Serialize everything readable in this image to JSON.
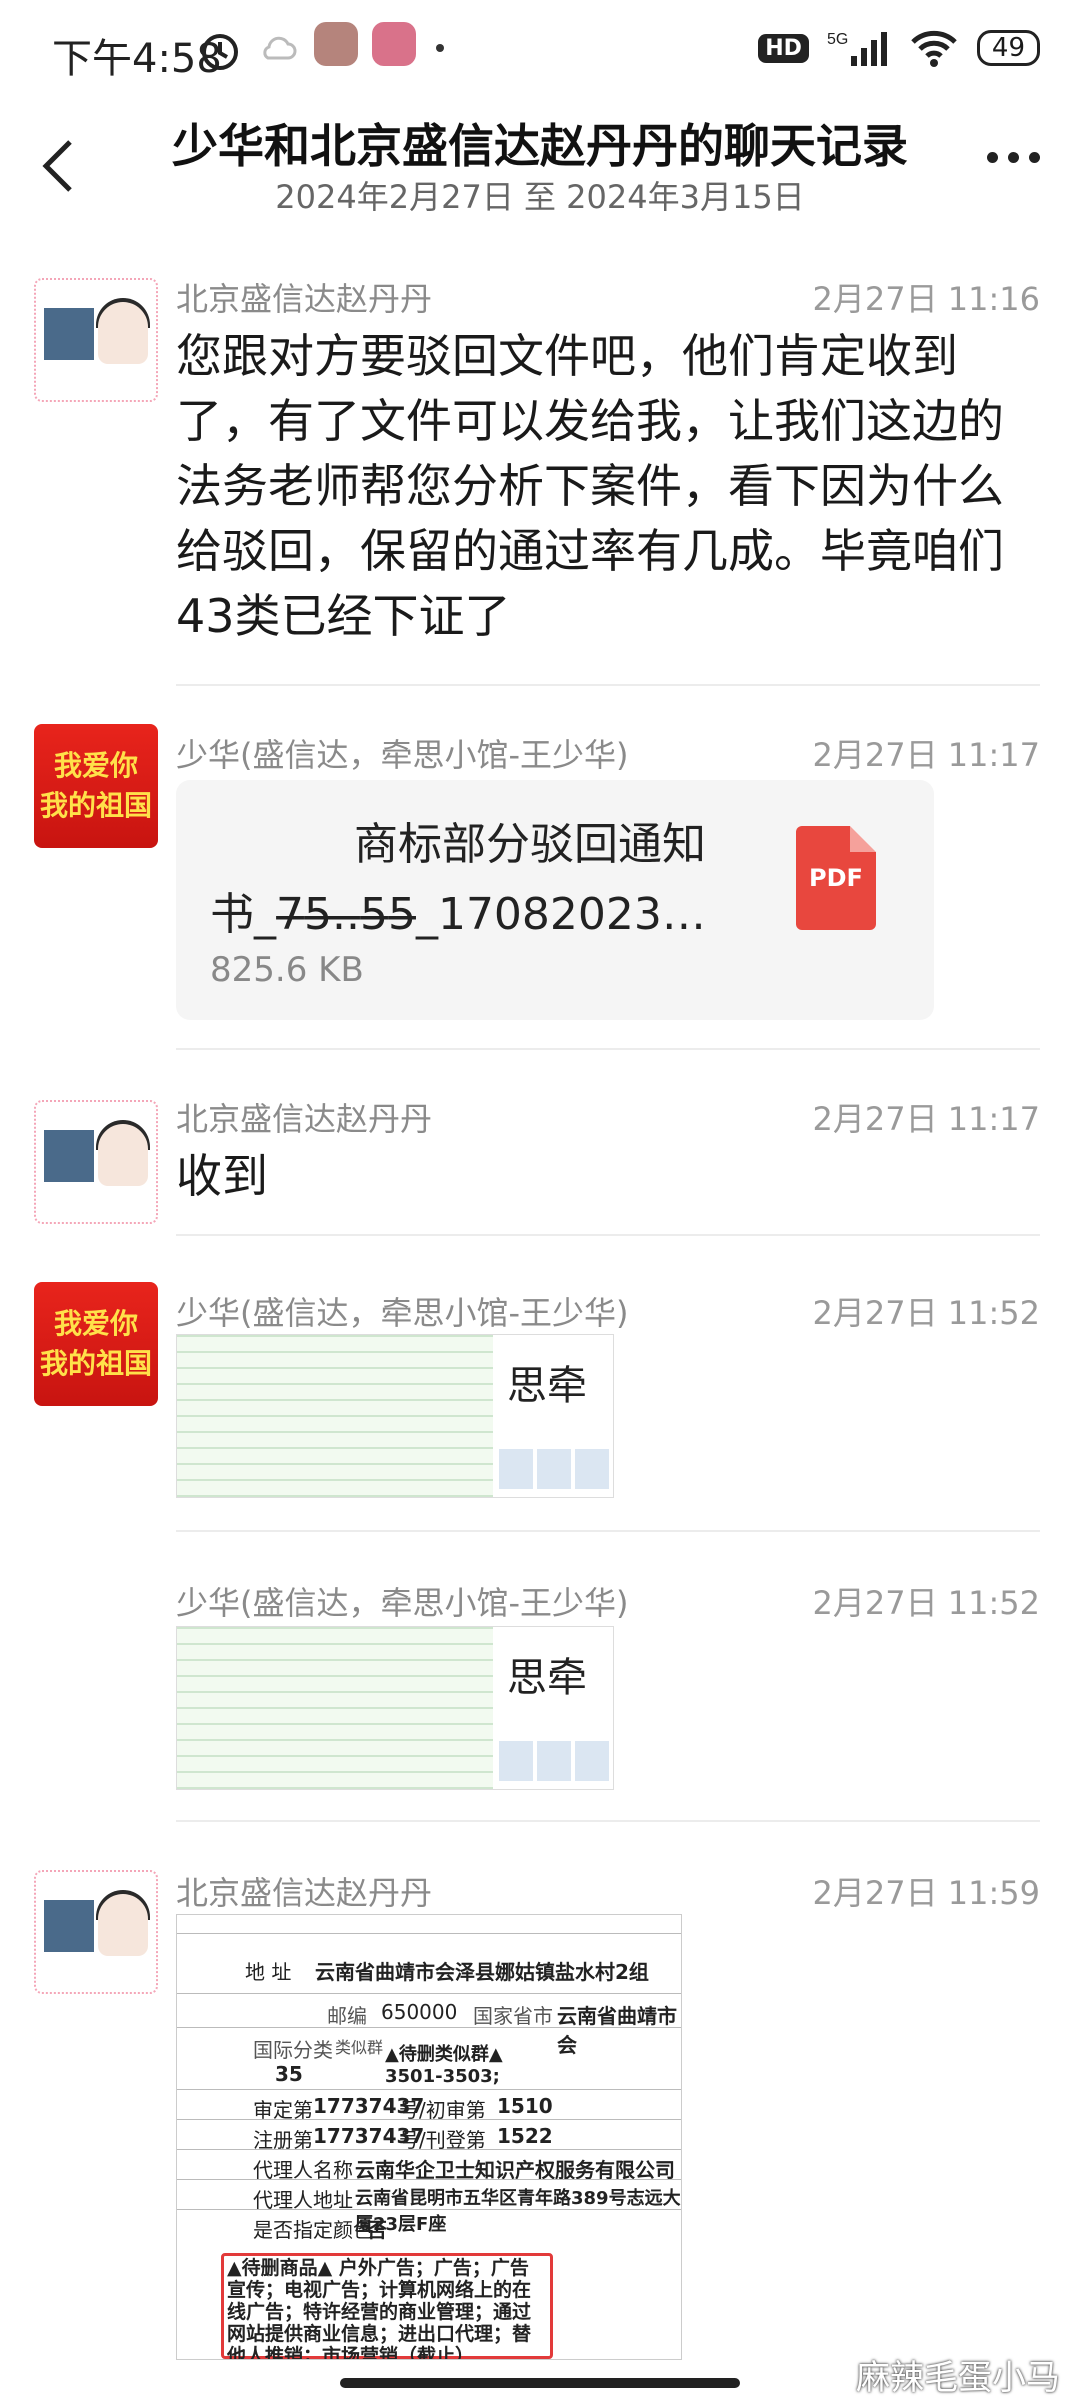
{
  "status_bar": {
    "time": "下午4:58",
    "network": "5G",
    "hd": "HD",
    "battery": "49"
  },
  "header": {
    "title": "少华和北京盛信达赵丹丹的聊天记录",
    "subtitle": "2024年2月27日 至 2024年3月15日"
  },
  "messages": [
    {
      "sender": "北京盛信达赵丹丹",
      "time": "2月27日 11:16",
      "text": "您跟对方要驳回文件吧，他们肯定收到了，有了文件可以发给我，让我们这边的法务老师帮您分析下案件，看下因为什么给驳回，保留的通过率有几成。毕竟咱们43类已经下证了"
    },
    {
      "sender": "少华(盛信达，牵思小馆-王少华)",
      "time": "2月27日 11:17",
      "avatar_text": [
        "我爱你",
        "我的祖国"
      ],
      "file": {
        "name_line1": "商标部分驳回通知",
        "name_line2": "书_7̶5̶.̶.̶5̶5̶_17082023…",
        "size": "825.6 KB",
        "type": "PDF"
      }
    },
    {
      "sender": "北京盛信达赵丹丹",
      "time": "2月27日 11:17",
      "text": "收到"
    },
    {
      "sender": "少华(盛信达，牵思小馆-王少华)",
      "time": "2月27日 11:52",
      "avatar_text": [
        "我爱你",
        "我的祖国"
      ],
      "image_text": "思牵"
    },
    {
      "sender": "少华(盛信达，牵思小馆-王少华)",
      "time": "2月27日 11:52",
      "image_text": "思牵"
    },
    {
      "sender": "北京盛信达赵丹丹",
      "time": "2月27日 11:59",
      "document": {
        "address_label": "地 址",
        "address": "云南省曲靖市会泽县娜姑镇盐水村2组",
        "postcode_label": "邮编",
        "postcode": "650000",
        "country_label": "国家省市",
        "province": "云南省曲靖市会",
        "class_label": "国际分类",
        "class": "35",
        "group_label": "类似群",
        "group": "▲待删类似群▲ 3501-3503;",
        "review_no_label": "审定第",
        "review_no": "17737437",
        "issue_label": "号/初审第",
        "issue": "1510",
        "reg_no_label": "注册第",
        "reg_no": "17737437",
        "reg_issue_label": "号/刊登第",
        "reg_issue": "1522",
        "agent_label": "代理人名称",
        "agent": "云南华企卫士知识产权服务有限公司",
        "agent_addr_label": "代理人地址",
        "agent_addr": "云南省昆明市五华区青年路389号志远大厦23层F座",
        "color_label": "是否指定颜色",
        "color": "否",
        "goods_text": "▲待删商品▲ 户外广告；广告；广告宣传；电视广告；计算机网络上的在线广告；特许经营的商业管理；通过网站提供商业信息；进出口代理；替他人推销；市场营销（截止）"
      }
    }
  ],
  "watermark": "麻辣毛蛋小马"
}
